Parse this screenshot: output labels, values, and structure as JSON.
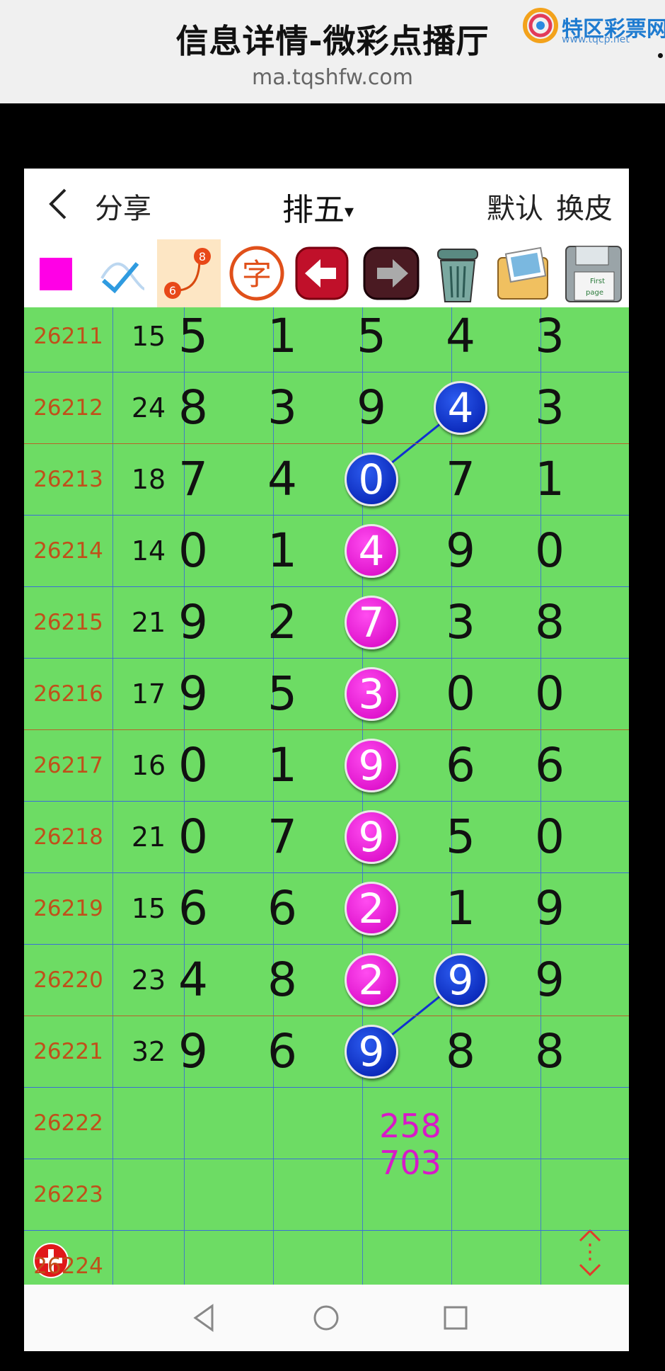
{
  "browser": {
    "title": "信息详情-微彩点播厅",
    "url": "ma.tqshfw.com",
    "logo_text": "特区彩票网",
    "logo_sub": "www.tqcp.net"
  },
  "header": {
    "back_label": "<",
    "share_label": "分享",
    "game_title": "排五",
    "caret": "▾",
    "default_label": "默认",
    "skin_label": "换皮"
  },
  "toolbar": {
    "tools": [
      "color-square",
      "pen",
      "line-connect",
      "char",
      "undo",
      "redo",
      "trash",
      "images",
      "save"
    ],
    "connect_numbers": [
      "8",
      "6"
    ],
    "char_glyph": "字",
    "save_text_1": "First",
    "save_text_2": "page"
  },
  "colors": {
    "issue_text": "#c0501a",
    "grid_bg": "#6ddc64",
    "ball_blue": "#0a2ad0",
    "ball_pink": "#e81ad8",
    "predict": "#d818c8"
  },
  "rows": [
    {
      "issue": "26211",
      "sum": "15",
      "digits": [
        "5",
        "1",
        "5",
        "4",
        "3"
      ],
      "balls": {}
    },
    {
      "issue": "26212",
      "sum": "24",
      "digits": [
        "8",
        "3",
        "9",
        "4",
        "3"
      ],
      "balls": {
        "3": "blue"
      }
    },
    {
      "issue": "26213",
      "sum": "18",
      "digits": [
        "7",
        "4",
        "0",
        "7",
        "1"
      ],
      "balls": {
        "2": "blue"
      }
    },
    {
      "issue": "26214",
      "sum": "14",
      "digits": [
        "0",
        "1",
        "4",
        "9",
        "0"
      ],
      "balls": {
        "2": "pink"
      }
    },
    {
      "issue": "26215",
      "sum": "21",
      "digits": [
        "9",
        "2",
        "7",
        "3",
        "8"
      ],
      "balls": {
        "2": "pink"
      }
    },
    {
      "issue": "26216",
      "sum": "17",
      "digits": [
        "9",
        "5",
        "3",
        "0",
        "0"
      ],
      "balls": {
        "2": "pink"
      }
    },
    {
      "issue": "26217",
      "sum": "16",
      "digits": [
        "0",
        "1",
        "9",
        "6",
        "6"
      ],
      "balls": {
        "2": "pink"
      }
    },
    {
      "issue": "26218",
      "sum": "21",
      "digits": [
        "0",
        "7",
        "9",
        "5",
        "0"
      ],
      "balls": {
        "2": "pink"
      }
    },
    {
      "issue": "26219",
      "sum": "15",
      "digits": [
        "6",
        "6",
        "2",
        "1",
        "9"
      ],
      "balls": {
        "2": "pink"
      }
    },
    {
      "issue": "26220",
      "sum": "23",
      "digits": [
        "4",
        "8",
        "2",
        "9",
        "9"
      ],
      "balls": {
        "2": "pink",
        "3": "blue"
      }
    },
    {
      "issue": "26221",
      "sum": "32",
      "digits": [
        "9",
        "6",
        "9",
        "8",
        "8"
      ],
      "balls": {
        "2": "blue"
      }
    },
    {
      "issue": "26222",
      "sum": "",
      "digits": [
        "",
        "",
        "",
        "",
        ""
      ],
      "balls": {}
    },
    {
      "issue": "26223",
      "sum": "",
      "digits": [
        "",
        "",
        "",
        "",
        ""
      ],
      "balls": {}
    },
    {
      "issue": "26224",
      "sum": "",
      "digits": [
        "",
        "",
        "",
        "",
        ""
      ],
      "balls": {}
    }
  ],
  "prediction": {
    "line1": "258",
    "line2": "703"
  },
  "nav": [
    "back-triangle",
    "home-circle",
    "recent-square"
  ]
}
